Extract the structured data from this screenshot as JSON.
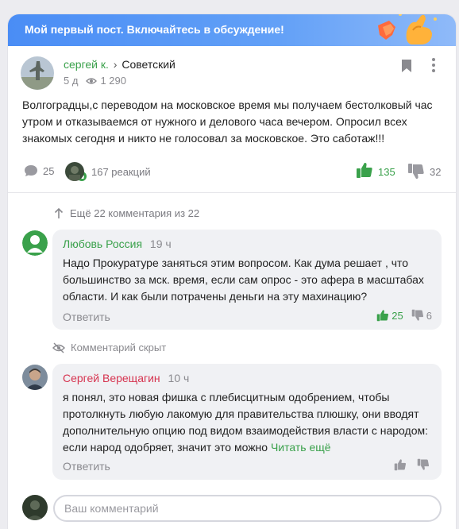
{
  "banner": {
    "title": "Мой первый пост. Включайтесь в обсуждение!"
  },
  "post": {
    "author": "сергей к.",
    "separator": "›",
    "location": "Советский",
    "age": "5 д",
    "views": "1 290",
    "text": "Волгоградцы,с переводом на московское время мы получаем бестолковый час утром и отказываемся от нужного и делового часа вечером. Опросил всех знакомых сегодня и никто не голосовал за московское. Это саботаж!!!",
    "comments_count": "25",
    "reactions": "167 реакций",
    "likes": "135",
    "dislikes": "32"
  },
  "thread": {
    "more_comments": "Ещё 22 комментария из 22",
    "hidden_comment": "Комментарий скрыт",
    "read_more": "Читать ещё",
    "reply_label": "Ответить",
    "comments": [
      {
        "author": "Любовь Россия",
        "time": "19 ч",
        "text": "Надо Прокуратуре заняться этим вопросом. Как дума решает , что большинство за мск. время, если сам опрос - это афера в масштабах области. И как были потрачены деньги на эту махинацию?",
        "likes": "25",
        "dislikes": "6"
      },
      {
        "author": "Сергей Верещагин",
        "time": "10 ч",
        "text": "я понял, это новая фишка с плебисцитным одобрением, чтобы протолкнуть любую лакомую для правительства плюшку, они вводят дополнительную опцию под видом взаимодействия власти с народом: если народ одобряет, значит это можно",
        "likes": "",
        "dislikes": ""
      }
    ]
  },
  "composer": {
    "placeholder": "Ваш комментарий"
  },
  "colors": {
    "accent_green": "#3aa14b",
    "banner_blue": "#4a8df5",
    "author_red": "#d6334f"
  }
}
